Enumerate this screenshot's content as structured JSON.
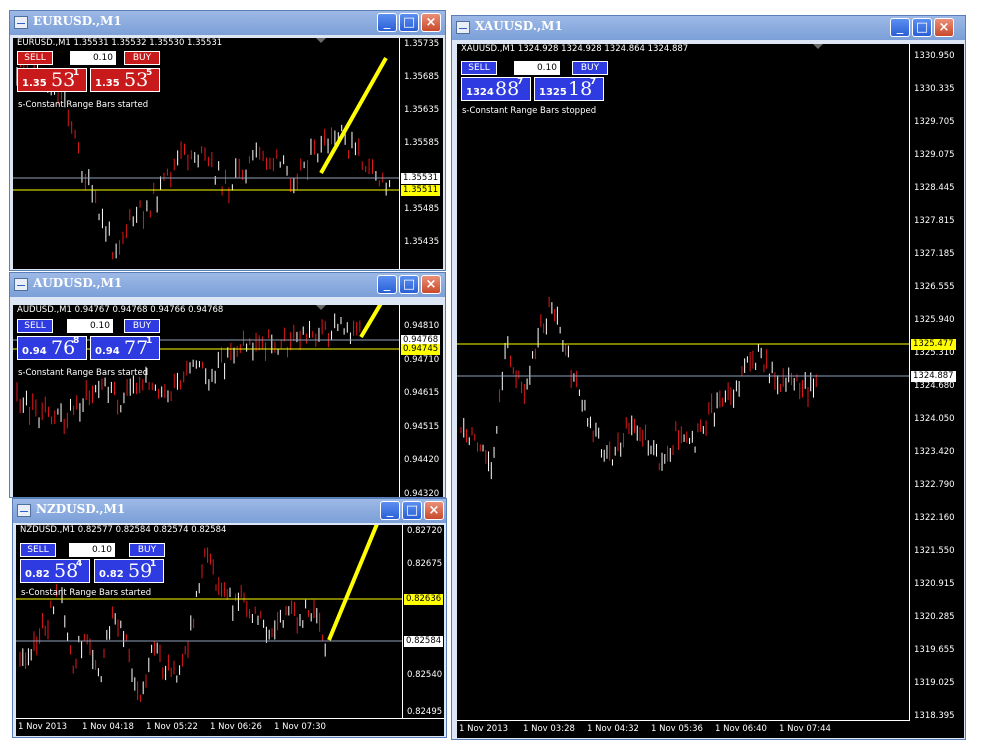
{
  "windows": [
    {
      "title": "EURUSD.,M1",
      "info": "EURUSD.,M1  1.35531 1.35532 1.35530 1.35531",
      "panel": {
        "sell": "SELL",
        "buy": "BUY",
        "lots": "0.10",
        "sell_big": "1.35",
        "sell_pips": "53",
        "sell_frac": "1",
        "buy_big": "1.35",
        "buy_pips": "53",
        "buy_frac": "5"
      },
      "status": "s-Constant Range Bars started",
      "price_ticks": [
        "1.35735",
        "1.35685",
        "1.35635",
        "1.35585",
        "1.35485",
        "1.35435"
      ],
      "tags": {
        "white": "1.35531",
        "yellow": "1.35511"
      },
      "date_ticks": []
    },
    {
      "title": "AUDUSD.,M1",
      "info": "AUDUSD.,M1  0.94767 0.94768 0.94766 0.94768",
      "panel": {
        "sell": "SELL",
        "buy": "BUY",
        "lots": "0.10",
        "sell_big": "0.94",
        "sell_pips": "76",
        "sell_frac": "8",
        "buy_big": "0.94",
        "buy_pips": "77",
        "buy_frac": "1"
      },
      "status": "s-Constant Range Bars started",
      "price_ticks": [
        "0.94810",
        "0.94710",
        "0.94615",
        "0.94515",
        "0.94420",
        "0.94320"
      ],
      "tags": {
        "white": "0.94768",
        "yellow": "0.94745"
      },
      "date_ticks": []
    },
    {
      "title": "NZDUSD.,M1",
      "info": "NZDUSD.,M1  0.82577 0.82584 0.82574 0.82584",
      "panel": {
        "sell": "SELL",
        "buy": "BUY",
        "lots": "0.10",
        "sell_big": "0.82",
        "sell_pips": "58",
        "sell_frac": "4",
        "buy_big": "0.82",
        "buy_pips": "59",
        "buy_frac": "1"
      },
      "status": "s-Constant Range Bars started",
      "price_ticks": [
        "0.82720",
        "0.82675",
        "0.82540",
        "0.82495"
      ],
      "tags": {
        "white": "0.82584",
        "yellow": "0.82636"
      },
      "date_ticks": [
        "1 Nov 2013",
        "1 Nov 04:18",
        "1 Nov 05:22",
        "1 Nov 06:26",
        "1 Nov 07:30"
      ]
    },
    {
      "title": "XAUUSD.,M1",
      "info": "XAUUSD.,M1  1324.928 1324.928 1324.864 1324.887",
      "panel": {
        "sell": "SELL",
        "buy": "BUY",
        "lots": "0.10",
        "sell_big": "1324",
        "sell_pips": "88",
        "sell_frac": "7",
        "buy_big": "1325",
        "buy_pips": "18",
        "buy_frac": "7"
      },
      "status": "s-Constant Range Bars stopped",
      "price_ticks": [
        "1330.950",
        "1330.335",
        "1329.705",
        "1329.075",
        "1328.445",
        "1327.815",
        "1327.185",
        "1326.555",
        "1325.940",
        "1325.310",
        "1324.680",
        "1324.050",
        "1323.420",
        "1322.790",
        "1322.160",
        "1321.550",
        "1320.915",
        "1320.285",
        "1319.655",
        "1319.025",
        "1318.395"
      ],
      "tags": {
        "white": "1324.887",
        "yellow": "1325.477"
      },
      "date_ticks": [
        "1 Nov 2013",
        "1 Nov 03:28",
        "1 Nov 04:32",
        "1 Nov 05:36",
        "1 Nov 06:40",
        "1 Nov 07:44"
      ]
    }
  ],
  "window_buttons": {
    "minimize": "_",
    "maximize": "□",
    "close": "×"
  },
  "colors": {
    "sell_red": "#c81a1a",
    "buy_blue": "#2e3be0",
    "chart_bg": "#000000",
    "bid_line": "#ffff00",
    "annotation": "#ffff00"
  },
  "icons": [
    "chart-window-icon",
    "minimize-icon",
    "maximize-icon",
    "close-icon"
  ]
}
